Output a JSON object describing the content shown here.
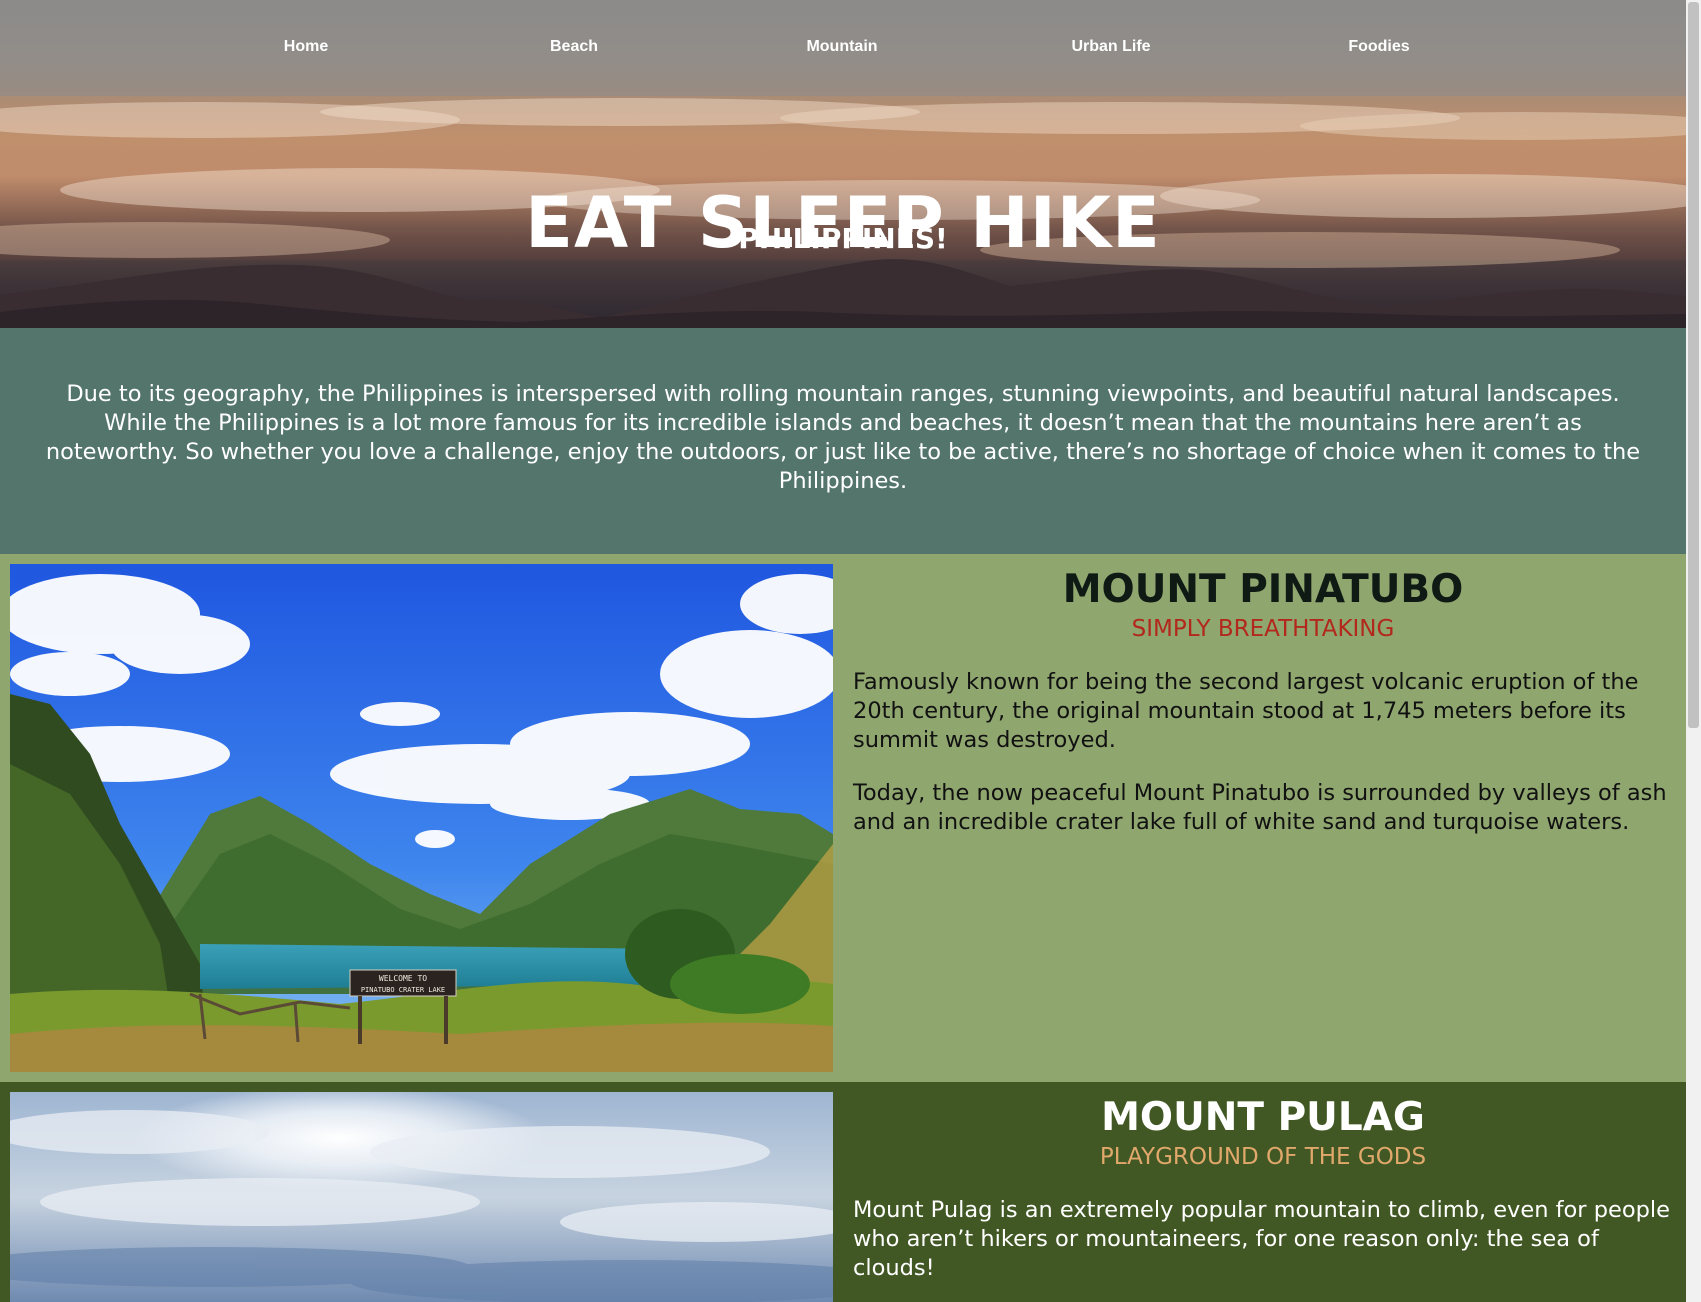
{
  "nav": {
    "items": [
      {
        "label": "Home"
      },
      {
        "label": "Beach"
      },
      {
        "label": "Mountain"
      },
      {
        "label": "Urban Life"
      },
      {
        "label": "Foodies"
      }
    ]
  },
  "hero": {
    "title": "EAT SLEEP HIKE",
    "subtitle": "PHILIPPINES!"
  },
  "intro": {
    "text": "Due to its geography, the Philippines is interspersed with rolling mountain ranges, stunning viewpoints, and beautiful natural landscapes. While the Philippines is a lot more famous for its incredible islands and beaches, it doesn’t mean that the mountains here aren’t as noteworthy. So whether you love a challenge, enjoy the outdoors, or just like to be active, there’s no shortage of choice when it comes to the Philippines."
  },
  "sections": [
    {
      "title": "MOUNT PINATUBO",
      "subtitle": "SIMPLY BREATHTAKING",
      "paragraphs": [
        "Famously known for being the second largest volcanic eruption of the 20th century, the original mountain stood at 1,745 meters before its summit was destroyed.",
        "Today, the now peaceful Mount Pinatubo is surrounded by valleys of ash and an incredible crater lake full of white sand and turquoise waters."
      ],
      "photo_sign": [
        "WELCOME TO",
        "PINATUBO CRATER LAKE"
      ]
    },
    {
      "title": "MOUNT PULAG",
      "subtitle": "PLAYGROUND OF THE GODS",
      "paragraphs": [
        "Mount Pulag is an extremely popular mountain to climb, even for people who aren’t hikers or mountaineers, for one reason only: the sea of clouds!"
      ]
    }
  ],
  "colors": {
    "intro_bg": "#53756b",
    "section1_bg": "#8fa66f",
    "section2_bg": "#415824",
    "section1_subtitle": "#b2281c",
    "section2_subtitle": "#e0a86a"
  }
}
